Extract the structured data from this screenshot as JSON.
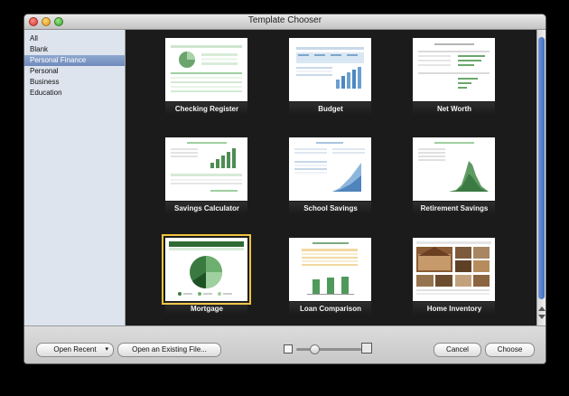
{
  "window": {
    "title": "Template Chooser"
  },
  "sidebar": {
    "items": [
      "All",
      "Blank",
      "Personal Finance",
      "Personal",
      "Business",
      "Education"
    ],
    "selected": "Personal Finance"
  },
  "templates": [
    {
      "label": "Checking Register",
      "icon": "spreadsheet-thumbnail"
    },
    {
      "label": "Budget",
      "icon": "spreadsheet-thumbnail"
    },
    {
      "label": "Net Worth",
      "icon": "spreadsheet-thumbnail"
    },
    {
      "label": "Savings Calculator",
      "icon": "spreadsheet-thumbnail"
    },
    {
      "label": "School Savings",
      "icon": "spreadsheet-thumbnail"
    },
    {
      "label": "Retirement Savings",
      "icon": "spreadsheet-thumbnail"
    },
    {
      "label": "Mortgage",
      "icon": "spreadsheet-thumbnail"
    },
    {
      "label": "Loan Comparison",
      "icon": "spreadsheet-thumbnail"
    },
    {
      "label": "Home Inventory",
      "icon": "spreadsheet-thumbnail"
    }
  ],
  "selected_template": "Mortgage",
  "footer": {
    "open_recent": "Open Recent",
    "open_existing": "Open an Existing File...",
    "cancel": "Cancel",
    "choose": "Choose"
  },
  "zoom_level": 0.2,
  "colors": {
    "accent": "#f0c33c",
    "selection": "#7a93c4",
    "finance_green": "#4f8d5a"
  }
}
